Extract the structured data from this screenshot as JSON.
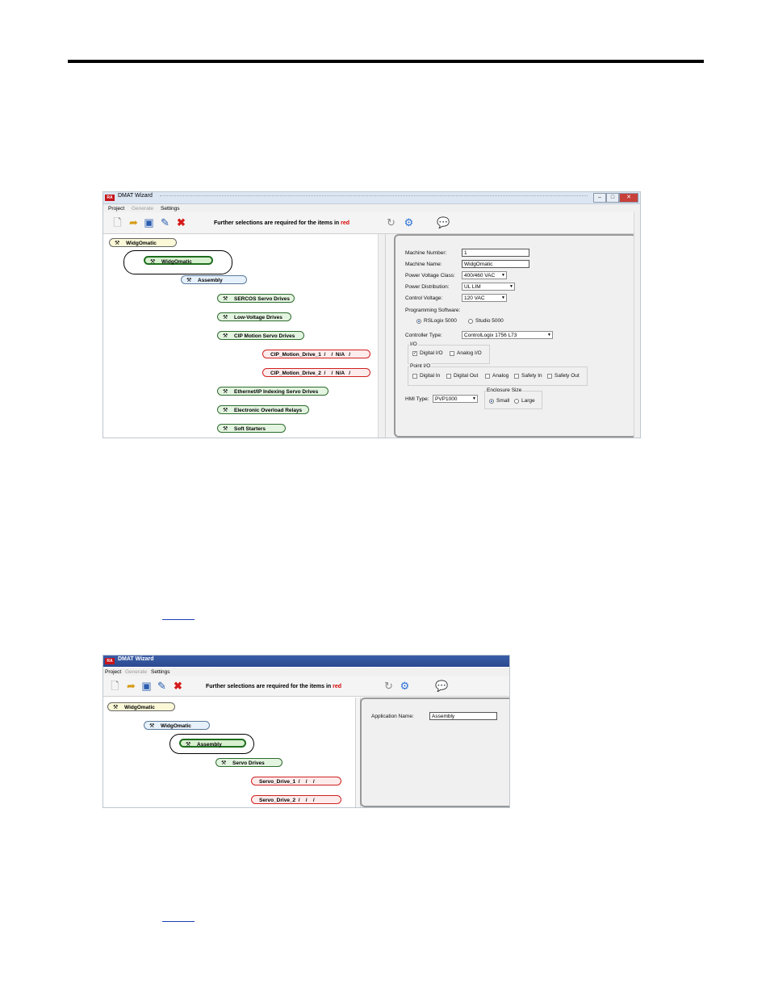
{
  "screenshot1": {
    "window_title": "DMAT Wizard",
    "menu": [
      "Project",
      "Generate",
      "Settings"
    ],
    "toolbar_notice_prefix": "Further selections are required for the items in",
    "toolbar_notice_red": "red",
    "tree": [
      "WidgOmatic",
      "WidgOmatic",
      "Assembly",
      "SERCOS Servo Drives",
      "Low-Voltage Drives",
      "CIP Motion Servo Drives",
      "CIP_Motion_Drive_1  /    /  N/A   /",
      "CIP_Motion_Drive_2  /    /  N/A   /",
      "Ethernet/IP Indexing Servo Drives",
      "Electronic Overload Relays",
      "Soft Starters"
    ],
    "form": {
      "machine_number_label": "Machine Number:",
      "machine_number_value": "1",
      "machine_name_label": "Machine Name:",
      "machine_name_value": "WidgOmatic",
      "power_voltage_class_label": "Power Voltage Class:",
      "power_voltage_class_value": "400/460 VAC",
      "power_distribution_label": "Power Distribution:",
      "power_distribution_value": "UL LIM",
      "control_voltage_label": "Control Voltage:",
      "control_voltage_value": "120 VAC",
      "programming_software_label": "Programming Software:",
      "sw_option_1": "RSLogix 5000",
      "sw_option_2": "Studio 5000",
      "controller_type_label": "Controller Type:",
      "controller_type_value": "ControlLogix 1756 L73",
      "io_label": "I/O",
      "io_digital": "Digital I/O",
      "io_analog": "Analog I/O",
      "point_io_label": "Point I/O",
      "pio_digital_in": "Digital In",
      "pio_digital_out": "Digital Out",
      "pio_analog": "Analog",
      "pio_safety_in": "Safety In",
      "pio_safety_out": "Safety Out",
      "hmi_type_label": "HMI Type:",
      "hmi_type_value": "PVP1000",
      "enclosure_size_label": "Enclosure Size",
      "enclosure_small": "Small",
      "enclosure_large": "Large"
    }
  },
  "screenshot2": {
    "window_title": "DMAT Wizard",
    "menu": [
      "Project",
      "Generate",
      "Settings"
    ],
    "toolbar_notice_prefix": "Further selections are required for the items in",
    "toolbar_notice_red": "red",
    "tree": [
      "WidgOmatic",
      "WidgOmatic",
      "Assembly",
      "Servo Drives",
      "Servo_Drive_1  /    /    /",
      "Servo_Drive_2  /    /    /"
    ],
    "form": {
      "application_name_label": "Application Name:",
      "application_name_value": "Assembly"
    }
  },
  "colors": {
    "error": "#d60000",
    "selected": "#1f6e1f",
    "link": "#1a3fb3"
  }
}
